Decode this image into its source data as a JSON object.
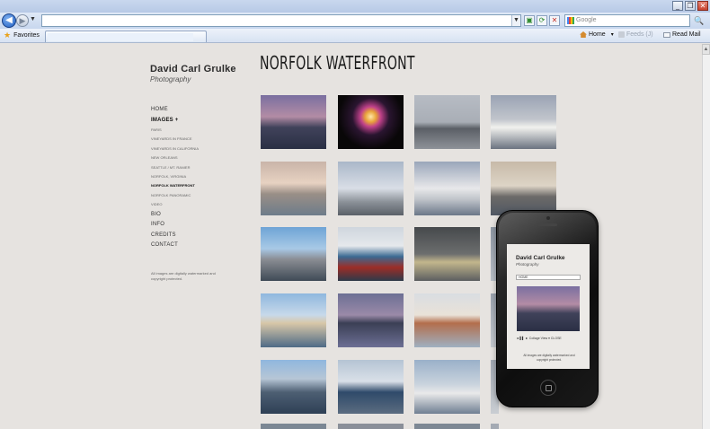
{
  "browser": {
    "window_buttons": [
      "_",
      "❐",
      "✕"
    ],
    "address": {
      "value": "",
      "placeholder": ""
    },
    "search": {
      "placeholder": "Google",
      "button": "🔍"
    },
    "favorites_label": "Favorites",
    "commands": {
      "home": "Home",
      "feeds": "Feeds (J)",
      "mail": "Read Mail"
    }
  },
  "site": {
    "title": "David Carl Grulke",
    "subtitle": "Photography",
    "page_heading": "NORFOLK WATERFRONT",
    "menu": [
      {
        "label": "HOME",
        "type": "main"
      },
      {
        "label": "IMAGES +",
        "type": "main",
        "bold": true
      },
      {
        "label": "PARIS",
        "type": "sub"
      },
      {
        "label": "VINEYARDS IN FRANCE",
        "type": "sub"
      },
      {
        "label": "VINEYARDS IN CALIFORNIA",
        "type": "sub"
      },
      {
        "label": "NEW ORLEANS",
        "type": "sub"
      },
      {
        "label": "SEATTLE / MT. RANIER",
        "type": "sub"
      },
      {
        "label": "NORFOLK, VIRGINIA",
        "type": "sub"
      },
      {
        "label": "NORFOLK WATERFRONT",
        "type": "sub",
        "active": true
      },
      {
        "label": "NORFOLK PANORAMIC",
        "type": "sub"
      },
      {
        "label": "VIDEO",
        "type": "sub"
      },
      {
        "label": "BIO",
        "type": "main"
      },
      {
        "label": "INFO",
        "type": "main"
      },
      {
        "label": "CREDITS",
        "type": "main"
      },
      {
        "label": "CONTACT",
        "type": "main"
      }
    ],
    "footer_note": "All images are digitally watermarked and copyright protected.",
    "thumbnails": [
      "battleship-night",
      "fireworks",
      "tugboat-skyline",
      "ferry-boat",
      "harbor-buildings",
      "tall-ship-masts",
      "cruise-ship",
      "tugboat-dusk",
      "battleship-day",
      "tugboat-red",
      "storm-waterfront",
      "harbor-partial",
      "city-reflection",
      "battleship-reflection",
      "marina-buildings",
      "harbor-partial-2",
      "tug-city",
      "tug-crane",
      "cruise-ship-dock",
      "harbor-partial-3"
    ]
  },
  "phone": {
    "title": "David Carl Grulke",
    "subtitle": "Photography",
    "select_value": "HOME",
    "controls": "◄ ▌▌ ►      Collage View ▾           CLOSE",
    "note": "All images are digitally watermarked and copyright protected."
  },
  "colors": {
    "page_bg": "#e6e3e0",
    "text_dark": "#1b1b1b",
    "ie_blue": "#1f5fc2"
  }
}
